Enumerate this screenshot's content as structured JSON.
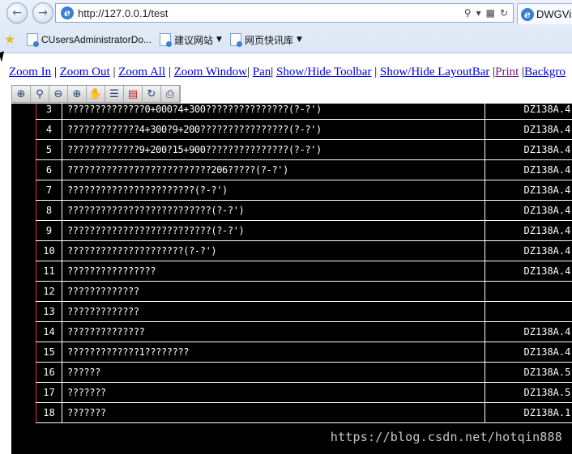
{
  "browser": {
    "url": "http://127.0.0.1/test",
    "tab_title": "DWGVi",
    "favorites": [
      {
        "label": "CUsersAdministratorDo..."
      },
      {
        "label": "建议网站"
      },
      {
        "label": "网页快讯库"
      }
    ]
  },
  "links": [
    {
      "label": "Zoom In"
    },
    {
      "label": "Zoom Out"
    },
    {
      "label": "Zoom All"
    },
    {
      "label": "Zoom Window"
    },
    {
      "label": "Pan"
    },
    {
      "label": "Show/Hide Toolbar"
    },
    {
      "label": "Show/Hide LayoutBar"
    },
    {
      "label": "Print"
    },
    {
      "label": "Backgro"
    }
  ],
  "toolbar_icons": [
    "zoom-in-icon",
    "zoom-window-icon",
    "zoom-out-icon",
    "zoom-all-icon",
    "pan-icon",
    "layers-icon",
    "background-icon",
    "regen-icon",
    "print-icon"
  ],
  "table": {
    "rows": [
      {
        "num": "3",
        "desc": "??????????????0+000?4+300???????????????(?-?')",
        "code": "DZ138A.4-"
      },
      {
        "num": "4",
        "desc": "?????????????4+300?9+200????????????????(?-?')",
        "code": "DZ138A.4-"
      },
      {
        "num": "5",
        "desc": "?????????????9+200?15+900???????????????(?-?')",
        "code": "DZ138A.4-"
      },
      {
        "num": "6",
        "desc": "??????????????????????????206?????(?-?')",
        "code": "DZ138A.4-"
      },
      {
        "num": "7",
        "desc": "???????????????????????(?-?')",
        "code": "DZ138A.4-"
      },
      {
        "num": "8",
        "desc": "??????????????????????????(?-?')",
        "code": "DZ138A.4-"
      },
      {
        "num": "9",
        "desc": "??????????????????????????(?-?')",
        "code": "DZ138A.4-"
      },
      {
        "num": "10",
        "desc": "?????????????????????(?-?')",
        "code": "DZ138A.4-"
      },
      {
        "num": "11",
        "desc": "????????????????",
        "code": "DZ138A.4-"
      },
      {
        "num": "12",
        "desc": "?????????????",
        "code": ""
      },
      {
        "num": "13",
        "desc": "?????????????",
        "code": ""
      },
      {
        "num": "14",
        "desc": "??????????????",
        "code": "DZ138A.4-"
      },
      {
        "num": "15",
        "desc": "?????????????1????????",
        "code": "DZ138A.4-"
      },
      {
        "num": "16",
        "desc": "??????",
        "code": "DZ138A.5"
      },
      {
        "num": "17",
        "desc": "???????",
        "code": "DZ138A.5-"
      },
      {
        "num": "18",
        "desc": "???????",
        "code": "DZ138A.1-"
      }
    ]
  },
  "watermark": "https://blog.csdn.net/hotqin888"
}
